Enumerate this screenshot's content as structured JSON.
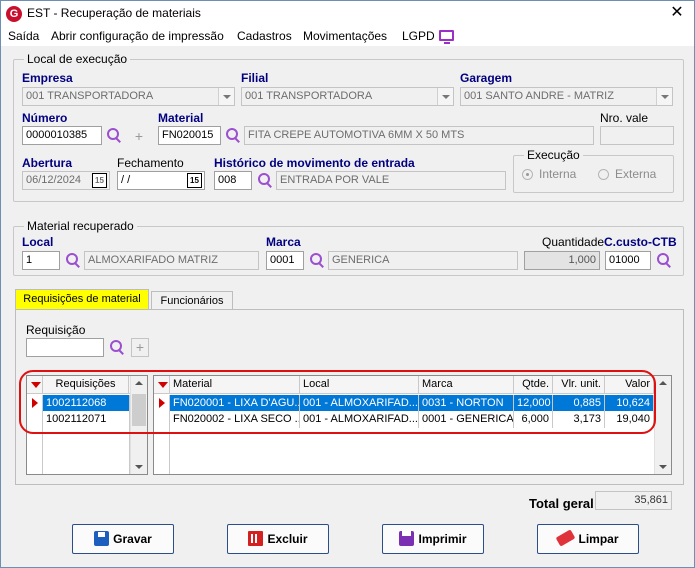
{
  "window": {
    "app_icon_letter": "G",
    "title": "EST - Recuperação de materiais",
    "close_glyph": "✕"
  },
  "menu": [
    "Saída",
    "Abrir configuração de impressão",
    "Cadastros",
    "Movimentações",
    "LGPD"
  ],
  "execucao_local": {
    "legend": "Local de execução",
    "empresa_label": "Empresa",
    "empresa_value": "001 TRANSPORTADORA",
    "filial_label": "Filial",
    "filial_value": "001 TRANSPORTADORA",
    "garagem_label": "Garagem",
    "garagem_value": "001 SANTO ANDRE - MATRIZ",
    "numero_label": "Número",
    "numero_value": "0000010385",
    "material_label": "Material",
    "material_code": "FN020015",
    "material_desc": "FITA CREPE AUTOMOTIVA 6MM X 50 MTS",
    "nro_vale_label": "Nro. vale",
    "nro_vale_value": "",
    "abertura_label": "Abertura",
    "abertura_value": "06/12/2024",
    "fechamento_label": "Fechamento",
    "fechamento_value": " / /",
    "calendar_glyph": "15",
    "historico_label": "Histórico de movimento de entrada",
    "historico_code": "008",
    "historico_desc": "ENTRADA POR VALE",
    "execucao_legend": "Execução",
    "execucao_options": [
      "Interna",
      "Externa"
    ]
  },
  "material_recuperado": {
    "legend": "Material recuperado",
    "local_label": "Local",
    "local_code": "1",
    "local_desc": "ALMOXARIFADO MATRIZ",
    "marca_label": "Marca",
    "marca_code": "0001",
    "marca_desc": "GENERICA",
    "quantidade_label": "Quantidade",
    "quantidade_value": "1,000",
    "ccusto_label": "C.custo-CTB",
    "ccusto_value": "01000"
  },
  "tabs": [
    "Requisições de material",
    "Funcionários"
  ],
  "requisicao": {
    "label": "Requisição",
    "value": "",
    "plus_glyph": "+"
  },
  "req_grid": {
    "header": "Requisições",
    "rows": [
      "1002112068",
      "1002112071"
    ],
    "selected_index": 0
  },
  "items_grid": {
    "columns": [
      "Material",
      "Local",
      "Marca",
      "Qtde.",
      "Vlr. unit.",
      "Valor"
    ],
    "rows": [
      [
        "FN020001 - LIXA D'AGU...",
        "001 - ALMOXARIFAD...",
        "0031 - NORTON",
        "12,000",
        "0,885",
        "10,624"
      ],
      [
        "FN020002 - LIXA SECO ...",
        "001 - ALMOXARIFAD...",
        "0001 - GENERICA",
        "6,000",
        "3,173",
        "19,040"
      ]
    ],
    "selected_index": 0
  },
  "total": {
    "label": "Total geral",
    "value": "35,861"
  },
  "buttons": {
    "gravar": "Gravar",
    "excluir": "Excluir",
    "imprimir": "Imprimir",
    "limpar": "Limpar"
  },
  "colors": {
    "selection": "#0078d7",
    "active_tab": "#ffff00",
    "label_blue": "#000080",
    "highlight_outline": "#e01010",
    "search_icon": "#9b4fd0"
  }
}
